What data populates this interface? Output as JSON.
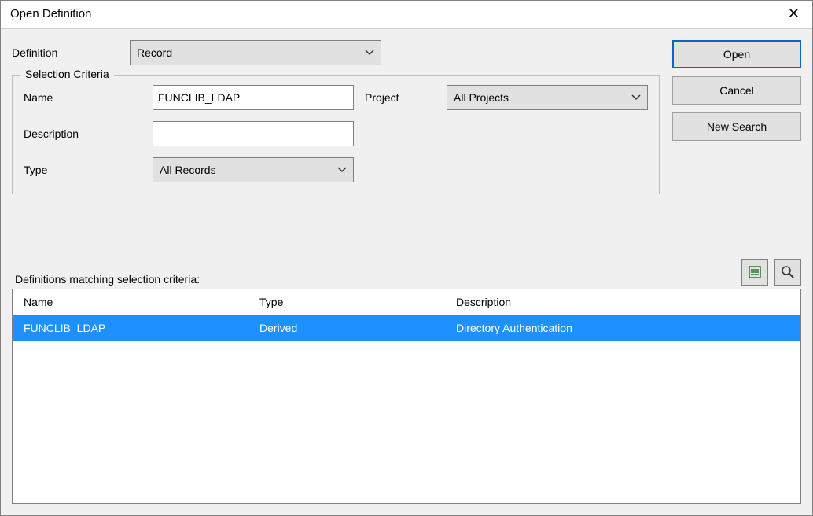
{
  "window": {
    "title": "Open Definition"
  },
  "labels": {
    "definition": "Definition",
    "selection_criteria": "Selection Criteria",
    "name": "Name",
    "project": "Project",
    "description": "Description",
    "type": "Type",
    "matching": "Definitions matching selection criteria:"
  },
  "fields": {
    "definition_value": "Record",
    "name_value": "FUNCLIB_LDAP",
    "description_value": "",
    "type_value": "All Records",
    "project_value": "All Projects"
  },
  "buttons": {
    "open": "Open",
    "cancel": "Cancel",
    "new_search": "New Search"
  },
  "list": {
    "columns": {
      "name": "Name",
      "type": "Type",
      "description": "Description"
    },
    "rows": [
      {
        "name": "FUNCLIB_LDAP",
        "type": "Derived",
        "description": "Directory Authentication",
        "selected": true
      }
    ]
  },
  "icons": {
    "list": "list-icon",
    "magnify": "magnify-icon"
  }
}
